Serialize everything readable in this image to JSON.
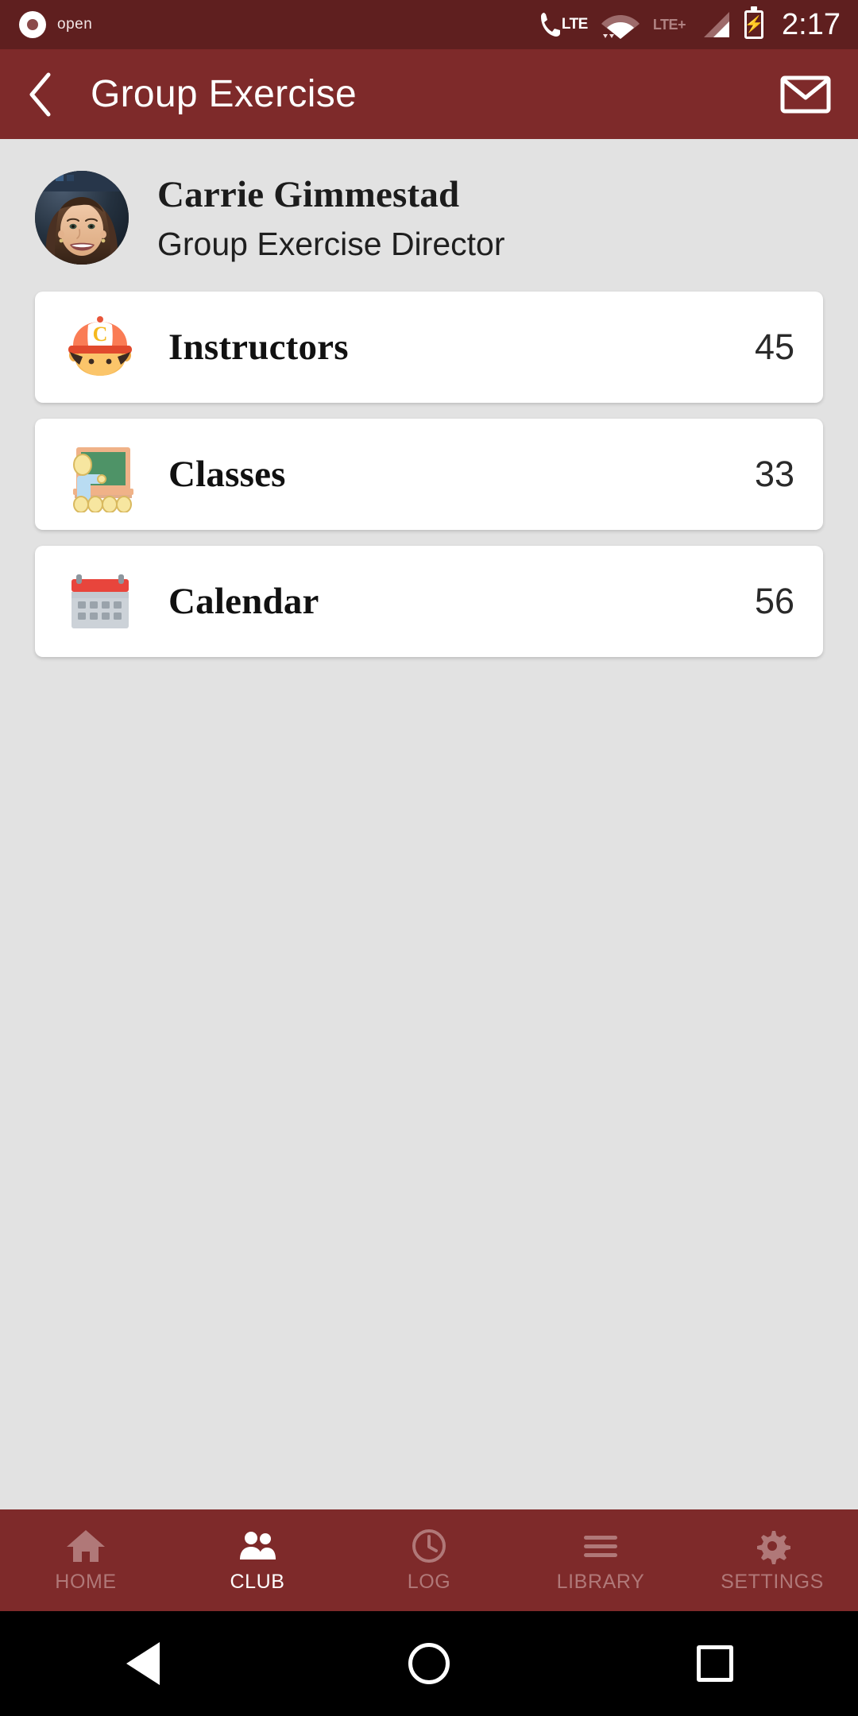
{
  "status_bar": {
    "carrier_label": "open",
    "time": "2:17",
    "icons": [
      "call-lte-icon",
      "wifi-icon",
      "lte-plus-icon",
      "signal-icon",
      "battery-charging-icon"
    ],
    "network_primary": "LTE",
    "network_secondary": "LTE+"
  },
  "app_bar": {
    "title": "Group Exercise",
    "back_icon": "chevron-left-icon",
    "mail_icon": "mail-icon"
  },
  "profile": {
    "name": "Carrie Gimmestad",
    "role": "Group Exercise Director",
    "avatar_icon": "user-photo-avatar"
  },
  "cards": [
    {
      "label": "Instructors",
      "count": "45",
      "icon": "instructor-cap-icon"
    },
    {
      "label": "Classes",
      "count": "33",
      "icon": "chalkboard-class-icon"
    },
    {
      "label": "Calendar",
      "count": "56",
      "icon": "calendar-icon"
    }
  ],
  "tabs": [
    {
      "label": "HOME",
      "icon": "home-icon",
      "active": false
    },
    {
      "label": "CLUB",
      "icon": "people-icon",
      "active": true
    },
    {
      "label": "LOG",
      "icon": "clock-icon",
      "active": false
    },
    {
      "label": "LIBRARY",
      "icon": "menu-lines-icon",
      "active": false
    },
    {
      "label": "SETTINGS",
      "icon": "gear-icon",
      "active": false
    }
  ],
  "android_nav": {
    "back_icon": "triangle-back-icon",
    "home_icon": "circle-home-icon",
    "recents_icon": "square-recents-icon"
  },
  "colors": {
    "status_bar": "#5f1f1f",
    "app_bar": "#7e2a2a",
    "background": "#e2e2e2",
    "card": "#ffffff",
    "tab_active": "#ffffff",
    "tab_inactive": "#b07878"
  }
}
